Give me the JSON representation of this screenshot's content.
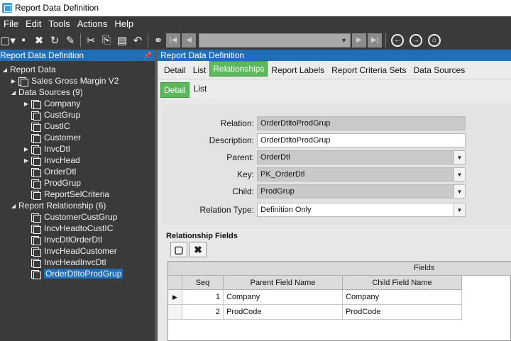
{
  "window": {
    "title": "Report Data Definition"
  },
  "menu": [
    "File",
    "Edit",
    "Tools",
    "Actions",
    "Help"
  ],
  "left_panel": {
    "header": "Report Data Definition",
    "pin_glyph": "📌",
    "tree": {
      "root": "Report Data",
      "report": "Sales Gross Margin V2",
      "data_sources_label": "Data Sources (9)",
      "data_sources": [
        "Company",
        "CustGrup",
        "CustIC",
        "Customer",
        "InvcDtl",
        "InvcHead",
        "OrderDtl",
        "ProdGrup",
        "ReportSelCriteria"
      ],
      "relationships_label": "Report Relationship (6)",
      "relationships": [
        "CustomerCustGrup",
        "IncvHeadtoCustIC",
        "InvcDtlOrderDtl",
        "InvcHeadCustomer",
        "InvcHeadInvcDtl",
        "OrderDtltoProdGrup"
      ],
      "selected": "OrderDtltoProdGrup"
    }
  },
  "right_panel": {
    "header": "Report Data Definition",
    "tabs": [
      "Detail",
      "List",
      "Relationships",
      "Report Labels",
      "Report Criteria Sets",
      "Data Sources"
    ],
    "active_tab": "Relationships",
    "subtabs": [
      "Detail",
      "List"
    ],
    "active_subtab": "Detail",
    "form": {
      "relation_label": "Relation:",
      "relation_value": "OrderDtltoProdGrup",
      "description_label": "Description:",
      "description_value": "OrderDtltoProdGrup",
      "parent_label": "Parent:",
      "parent_value": "OrderDtl",
      "key_label": "Key:",
      "key_value": "PK_OrderDtl",
      "child_label": "Child:",
      "child_value": "ProdGrup",
      "relation_type_label": "Relation Type:",
      "relation_type_value": "Definition Only"
    },
    "relationship_fields": {
      "title": "Relationship Fields",
      "band_label": "Fields",
      "columns": [
        "Seq",
        "Parent Field Name",
        "Child Field Name"
      ],
      "rows": [
        {
          "seq": "1",
          "parent": "Company",
          "child": "Company"
        },
        {
          "seq": "2",
          "parent": "ProdCode",
          "child": "ProdCode"
        }
      ]
    }
  },
  "icons": {
    "new": "new-icon",
    "save": "save-icon",
    "delete": "delete-icon",
    "refresh": "refresh-icon",
    "clear": "clear-icon",
    "cut": "cut-icon",
    "copy": "copy-icon",
    "paste": "paste-icon",
    "undo": "undo-icon",
    "search": "binoculars-icon",
    "first": "first-record-icon",
    "prev": "previous-record-icon",
    "next": "next-record-icon",
    "last": "last-record-icon",
    "back": "back-icon",
    "forward": "forward-icon",
    "home": "home-icon"
  },
  "colors": {
    "accent_blue": "#1f6fb8",
    "active_tab_green": "#5cb85c",
    "chrome_dark": "#3a3a3a"
  }
}
